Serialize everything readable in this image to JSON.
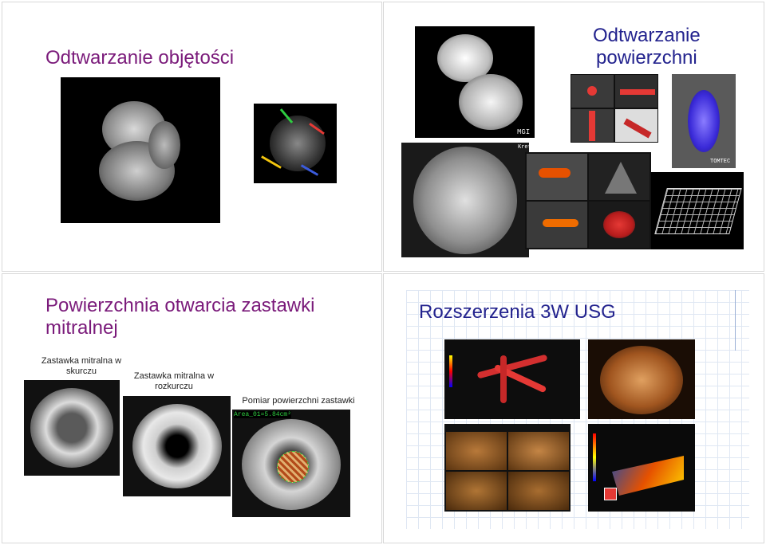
{
  "slides": {
    "tl": {
      "title": "Odtwarzanie objętości"
    },
    "tr": {
      "title_line1": "Odtwarzanie",
      "title_line2": "powierzchni",
      "mg_label": "MGI",
      "logo": "Kretz",
      "brand": "TOMTEC"
    },
    "bl": {
      "title_line1": "Powierzchnia otwarcia zastawki",
      "title_line2": "mitralnej",
      "caption1_line1": "Zastawka mitralna w",
      "caption1_line2": "skurczu",
      "caption2_line1": "Zastawka mitralna w",
      "caption2_line2": "rozkurczu",
      "caption3": "Pomiar powierzchni zastawki",
      "area_label": "Area_01=5.84cm²"
    },
    "br": {
      "title": "Rozszerzenia 3W USG"
    }
  },
  "colors": {
    "purple_title": "#7a1a7a",
    "blue_title": "#23238e",
    "grid": "#dfe7f3"
  }
}
